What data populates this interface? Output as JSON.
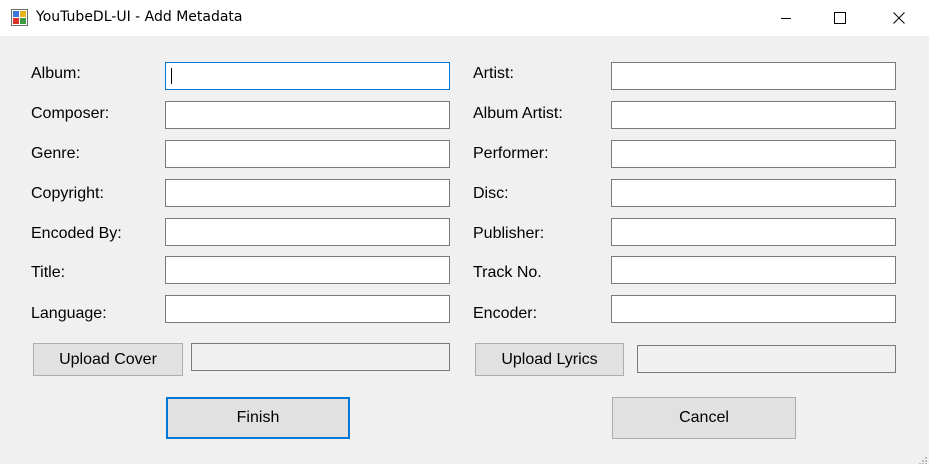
{
  "window": {
    "title": "YouTubeDL-UI - Add Metadata"
  },
  "fields": {
    "album": {
      "label": "Album:",
      "value": ""
    },
    "composer": {
      "label": "Composer:",
      "value": ""
    },
    "genre": {
      "label": "Genre:",
      "value": ""
    },
    "copyright": {
      "label": "Copyright:",
      "value": ""
    },
    "encoded_by": {
      "label": "Encoded By:",
      "value": ""
    },
    "title": {
      "label": "Title:",
      "value": ""
    },
    "language": {
      "label": "Language:",
      "value": ""
    },
    "artist": {
      "label": "Artist:",
      "value": ""
    },
    "album_artist": {
      "label": "Album Artist:",
      "value": ""
    },
    "performer": {
      "label": "Performer:",
      "value": ""
    },
    "disc": {
      "label": "Disc:",
      "value": ""
    },
    "publisher": {
      "label": "Publisher:",
      "value": ""
    },
    "track_no": {
      "label": "Track No.",
      "value": ""
    },
    "encoder": {
      "label": "Encoder:",
      "value": ""
    }
  },
  "uploads": {
    "cover_label": "Upload Cover",
    "cover_path": "",
    "lyrics_label": "Upload Lyrics",
    "lyrics_path": ""
  },
  "actions": {
    "finish_label": "Finish",
    "cancel_label": "Cancel"
  },
  "icons": {
    "app": "app-icon",
    "minimize": "minimize-icon",
    "maximize": "maximize-icon",
    "close": "close-icon",
    "resize_grip": "resize-grip-icon"
  },
  "colors": {
    "focus_border": "#0078d7",
    "window_bg": "#f0f0f0",
    "titlebar_bg": "#ffffff"
  }
}
